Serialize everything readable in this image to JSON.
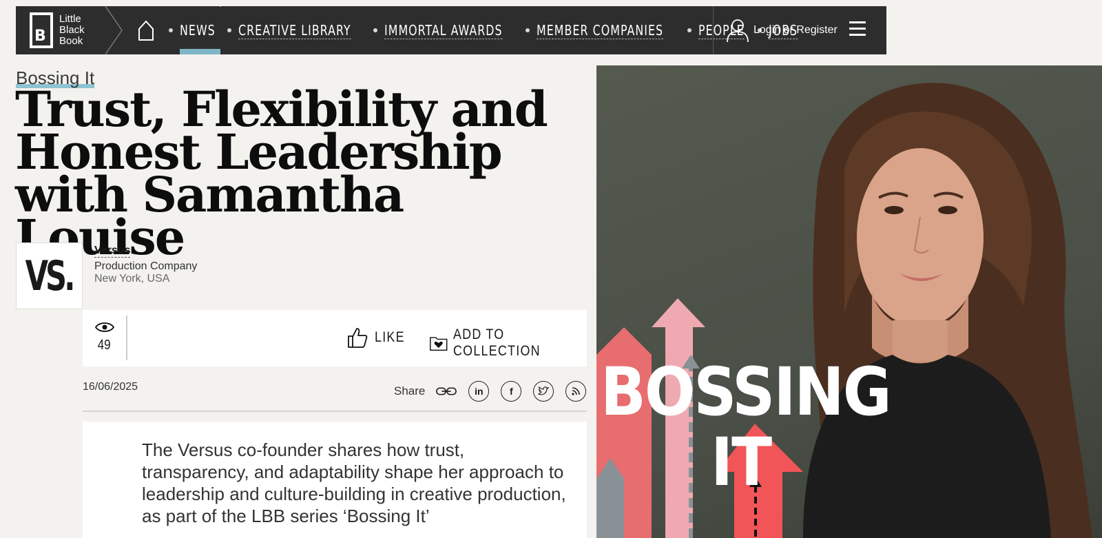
{
  "nav": {
    "logo_lines": [
      "Little",
      "Black",
      "Book"
    ],
    "links": [
      "NEWS",
      "CREATIVE LIBRARY",
      "IMMORTAL AWARDS",
      "MEMBER COMPANIES",
      "PEOPLE",
      "JOBS"
    ],
    "active_link": "NEWS",
    "login_label": "Login or Register"
  },
  "article": {
    "kicker": "Bossing It",
    "headline_lines": [
      "Trust, Flexibility and",
      "Honest Leadership",
      "with Samantha Louise"
    ],
    "intro": "The Versus co-founder shares how trust, transparency, and adaptability shape her approach to leadership and culture-building in creative production, as part of the LBB series ‘Bossing It’",
    "date": "16/06/2025"
  },
  "company": {
    "logo_text": "VS.",
    "name": "Versus",
    "type": "Production Company",
    "location": "New York, USA"
  },
  "actions": {
    "views": "49",
    "like_label": "LIKE",
    "collection_label": "ADD TO COLLECTION"
  },
  "share": {
    "label": "Share",
    "icons": [
      "link-icon",
      "linkedin-icon",
      "facebook-icon",
      "twitter-icon",
      "rss-icon"
    ]
  },
  "hero": {
    "text_line1": "BOSSING",
    "text_line2": "IT"
  },
  "colors": {
    "nav_bg": "#2d2d2d",
    "accent": "#7fb6c7",
    "page_bg": "#f3f2ee",
    "arrow_red": "#e76d6f",
    "arrow_pink": "#efaab1",
    "arrow_grey": "#8a9196"
  }
}
